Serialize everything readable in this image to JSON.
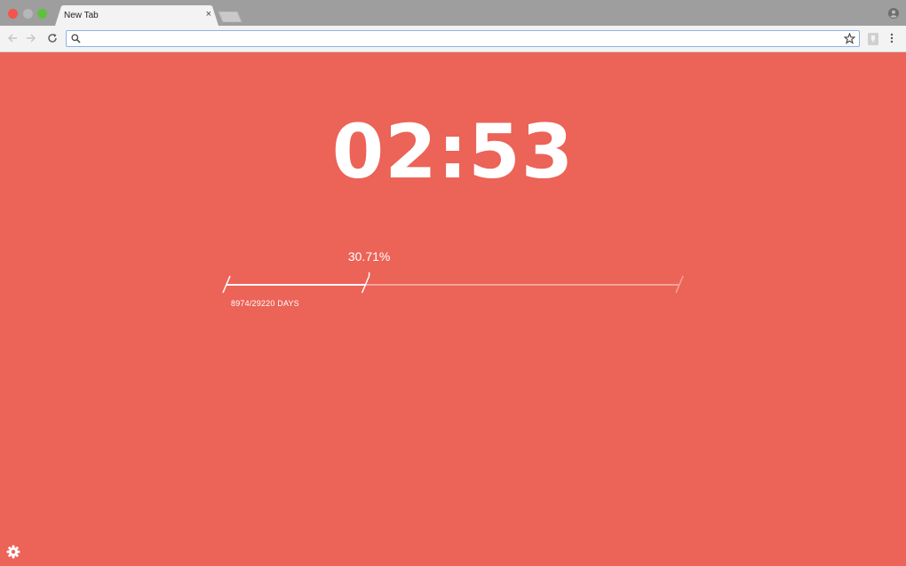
{
  "browser": {
    "tab": {
      "title": "New Tab",
      "close": "×"
    },
    "omnibox": {
      "value": "",
      "placeholder": ""
    }
  },
  "icons": {
    "back": "arrow-left-icon",
    "forward": "arrow-right-icon",
    "reload": "reload-icon",
    "search": "search-icon",
    "star": "star-icon",
    "extension": "extension-icon",
    "menu": "kebab-menu-icon",
    "profile": "profile-icon",
    "settings": "gear-icon"
  },
  "colors": {
    "background": "#ec6357",
    "foreground": "#ffffff",
    "progress_remaining": "#f3a39c"
  },
  "clock": {
    "time": "02:53"
  },
  "life_progress": {
    "percent_label": "30.71%",
    "days_label": "8974/29220 DAYS",
    "fraction": 0.3071
  }
}
